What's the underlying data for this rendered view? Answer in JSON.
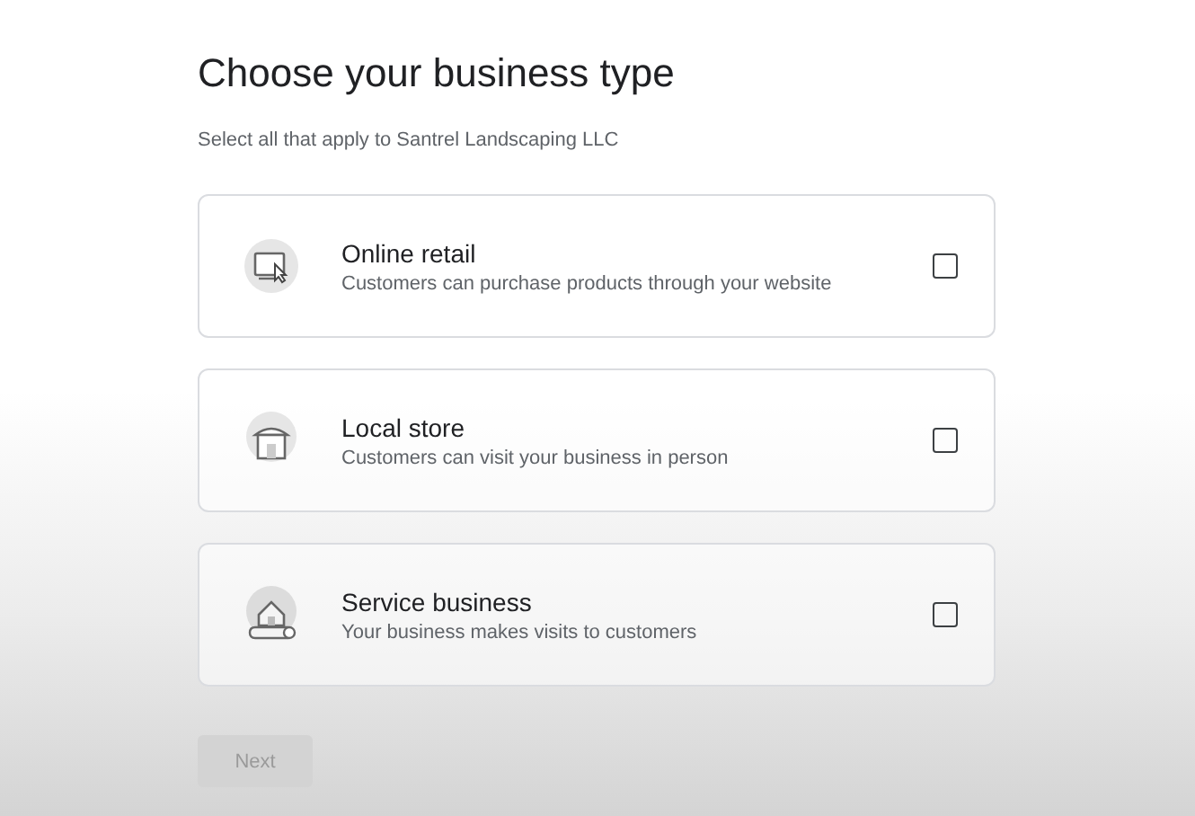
{
  "title": "Choose your business type",
  "subtitle": "Select all that apply to Santrel Landscaping LLC",
  "options": [
    {
      "kind": "retail",
      "label": "Online retail",
      "description": "Customers can purchase products through your website",
      "checked": false
    },
    {
      "kind": "store",
      "label": "Local store",
      "description": "Customers can visit your business in person",
      "checked": false
    },
    {
      "kind": "service",
      "label": "Service business",
      "description": "Your business makes visits to customers",
      "checked": false
    }
  ],
  "next_button": {
    "label": "Next",
    "disabled": true
  }
}
